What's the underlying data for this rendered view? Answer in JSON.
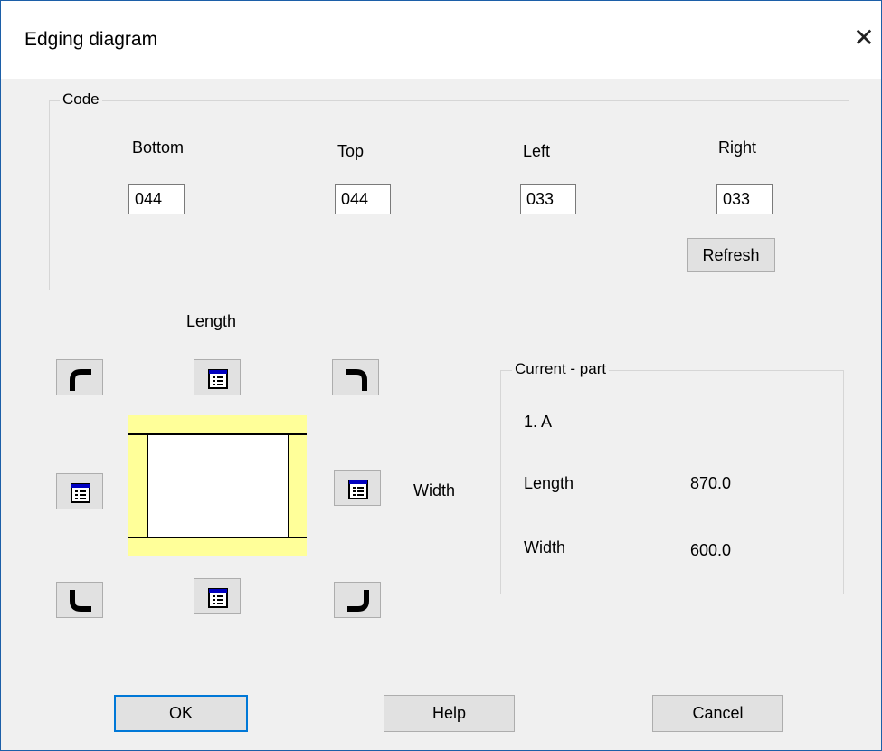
{
  "window": {
    "title": "Edging diagram",
    "close_glyph": "✕"
  },
  "code_group": {
    "label": "Code",
    "bottom": {
      "label": "Bottom",
      "value": "044"
    },
    "top": {
      "label": "Top",
      "value": "044"
    },
    "left": {
      "label": "Left",
      "value": "033"
    },
    "right": {
      "label": "Right",
      "value": "033"
    },
    "refresh_label": "Refresh"
  },
  "diagram": {
    "length_label": "Length",
    "width_label": "Width",
    "preview_edge_color": "#ffff99",
    "icons": {
      "corner_top_left": "corner-top-left-icon",
      "corner_top_right": "corner-top-right-icon",
      "corner_bottom_left": "corner-bottom-left-icon",
      "corner_bottom_right": "corner-bottom-right-icon",
      "edge": "list-window-icon"
    }
  },
  "current_part": {
    "label": "Current - part",
    "name": "1. A",
    "length_label": "Length",
    "length_value": "870.0",
    "width_label": "Width",
    "width_value": "600.0"
  },
  "buttons": {
    "ok": "OK",
    "help": "Help",
    "cancel": "Cancel"
  },
  "colors": {
    "accent": "#0078d7",
    "button_face": "#e1e1e1",
    "dialog_bg": "#f0f0f0"
  }
}
